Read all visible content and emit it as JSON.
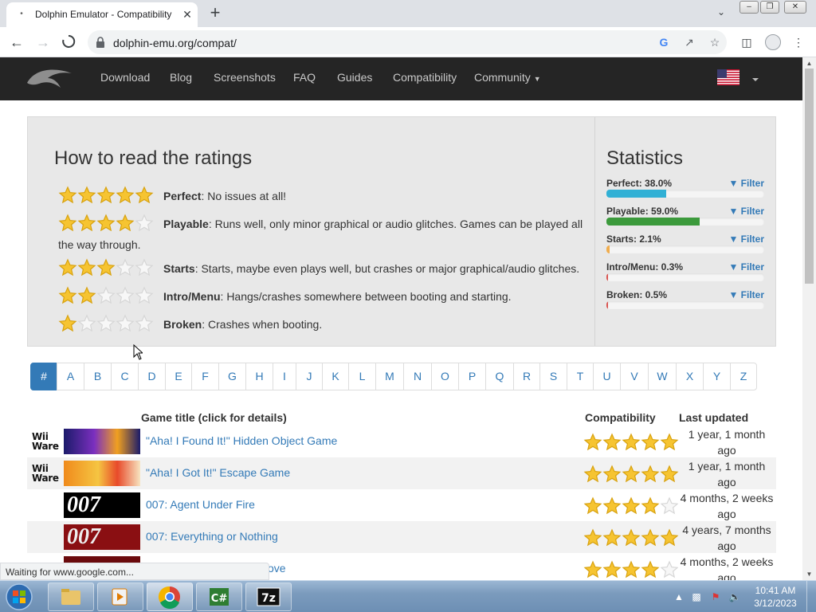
{
  "browser": {
    "tab_title": "Dolphin Emulator - Compatibility",
    "tab_close": "✕",
    "new_tab": "+",
    "url": "dolphin-emu.org/compat/",
    "status_text": "Waiting for www.google.com..."
  },
  "site_nav": {
    "links": [
      "Download",
      "Blog",
      "Screenshots",
      "FAQ",
      "Guides",
      "Compatibility",
      "Community"
    ]
  },
  "ratings_help": {
    "title": "How to read the ratings",
    "rows": [
      {
        "stars": 5,
        "label": "Perfect",
        "text": ": No issues at all!"
      },
      {
        "stars": 4,
        "label": "Playable",
        "text": ": Runs well, only minor graphical or audio glitches. Games can be played all the way through."
      },
      {
        "stars": 3,
        "label": "Starts",
        "text": ": Starts, maybe even plays well, but crashes or major graphical/audio glitches."
      },
      {
        "stars": 2,
        "label": "Intro/Menu",
        "text": ": Hangs/crashes somewhere between booting and starting."
      },
      {
        "stars": 1,
        "label": "Broken",
        "text": ": Crashes when booting."
      }
    ]
  },
  "statistics": {
    "title": "Statistics",
    "filter_label": "Filter",
    "items": [
      {
        "label": "Perfect: 38.0%",
        "percent": 38.0,
        "color": "#31b0d5"
      },
      {
        "label": "Playable: 59.0%",
        "percent": 59.0,
        "color": "#3c9a3c"
      },
      {
        "label": "Starts: 2.1%",
        "percent": 2.1,
        "color": "#f0ad4e"
      },
      {
        "label": "Intro/Menu: 0.3%",
        "percent": 0.3,
        "color": "#d9534f"
      },
      {
        "label": "Broken: 0.5%",
        "percent": 0.5,
        "color": "#d9534f"
      }
    ]
  },
  "pager": {
    "letters": [
      "#",
      "A",
      "B",
      "C",
      "D",
      "E",
      "F",
      "G",
      "H",
      "I",
      "J",
      "K",
      "L",
      "M",
      "N",
      "O",
      "P",
      "Q",
      "R",
      "S",
      "T",
      "U",
      "V",
      "W",
      "X",
      "Y",
      "Z"
    ],
    "active": "#"
  },
  "games_table": {
    "headers": {
      "title": "Game title (click for details)",
      "compat": "Compatibility",
      "updated": "Last updated"
    },
    "rows": [
      {
        "platform": "Wii Ware",
        "title": "\"Aha! I Found It!\" Hidden Object Game",
        "stars": 5,
        "updated_1": "1 year, 1 month",
        "updated_2": "ago",
        "thumb": "wiiware-found"
      },
      {
        "platform": "Wii Ware",
        "title": "\"Aha! I Got It!\" Escape Game",
        "stars": 5,
        "updated_1": "1 year, 1 month",
        "updated_2": "ago",
        "thumb": "wiiware-escape"
      },
      {
        "platform": "",
        "title": "007: Agent Under Fire",
        "stars": 4,
        "updated_1": "4 months, 2 weeks",
        "updated_2": "ago",
        "thumb": "007-white"
      },
      {
        "platform": "",
        "title": "007: Everything or Nothing",
        "stars": 5,
        "updated_1": "4 years, 7 months",
        "updated_2": "ago",
        "thumb": "007-red"
      },
      {
        "platform": "",
        "title": "ove",
        "stars": 4,
        "updated_1": "4 months, 2 weeks",
        "updated_2": "ago",
        "thumb": "007-red"
      }
    ]
  },
  "taskbar": {
    "clock_time": "10:41 AM",
    "clock_date": "3/12/2023"
  },
  "colors": {
    "link": "#337ab7",
    "nav_bg": "#252525",
    "star": "#f6c431"
  }
}
